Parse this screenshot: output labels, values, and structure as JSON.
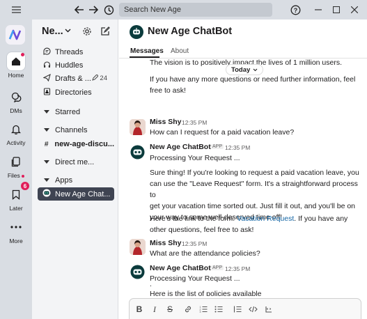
{
  "titlebar": {
    "search_placeholder": "Search New Age",
    "icons": [
      "hamburger-icon",
      "back-icon",
      "forward-icon",
      "history-icon",
      "help-icon",
      "minimize-icon",
      "maximize-icon",
      "close-icon"
    ]
  },
  "rail": {
    "workspace_logo": "N",
    "items": [
      {
        "label": "Home"
      },
      {
        "label": "DMs"
      },
      {
        "label": "Activity"
      },
      {
        "label": "Files"
      },
      {
        "label": "Later",
        "badge": "6"
      },
      {
        "label": "More"
      }
    ]
  },
  "sidebar": {
    "workspace_name": "Ne...",
    "items": [
      {
        "label": "Threads"
      },
      {
        "label": "Huddles"
      },
      {
        "label": "Drafts & ...",
        "count": "24"
      },
      {
        "label": "Directories"
      },
      {
        "label": "Starred"
      },
      {
        "label": "Channels"
      },
      {
        "label": "new-age-discu..."
      },
      {
        "label": "Direct me..."
      },
      {
        "label": "Apps"
      },
      {
        "label": "New Age Chat..."
      }
    ]
  },
  "channel": {
    "title": "New Age ChatBot",
    "tabs": [
      "Messages",
      "About"
    ],
    "today_label": "Today"
  },
  "messages": {
    "partial_1": "The vision is to positively impact the lives of 1 million users.",
    "partial_2a": "If you have any more questions or need further information, feel",
    "partial_2b": "free to ask!",
    "m1": {
      "sender": "Miss Shy",
      "time": "12:35 PM",
      "text": "How can I request for a paid vacation leave?"
    },
    "m2": {
      "sender": "New Age ChatBot",
      "app_tag": "APP",
      "time": "12:35 PM",
      "line1": "Processing Your Request ...",
      "p1a": "Sure thing! If you're looking to request a paid vacation leave, you",
      "p1b": "can use the \"Leave Request\" form. It's a straightforward process to",
      "p1c": "get your vacation time sorted out. Just fill it out, and you'll be on",
      "p1d": "your way to some well-deserved time off!",
      "p2a_prefix": "Here's the link to the form: ",
      "p2a_link": "Vacation Request",
      "p2a_suffix": ". If you have any",
      "p2b": "other questions, feel free to ask!"
    },
    "m3": {
      "sender": "Miss Shy",
      "time": "12:35 PM",
      "text": "What are the attendance policies?"
    },
    "m4": {
      "sender": "New Age ChatBot",
      "app_tag": "APP",
      "time": "12:35 PM",
      "line1": "Processing Your Request ...",
      "line2": "Here is the list of policies available",
      "line3": "."
    }
  },
  "composer": {
    "tools": [
      "bold-icon",
      "italic-icon",
      "strikethrough-icon",
      "link-icon",
      "ordered-list-icon",
      "bullet-list-icon",
      "blockquote-icon",
      "code-icon",
      "code-block-icon"
    ]
  }
}
